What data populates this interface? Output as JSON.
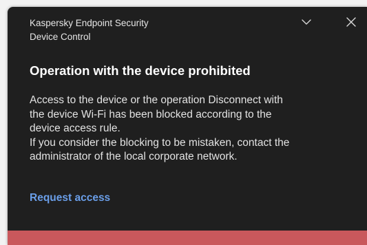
{
  "notification": {
    "app_name": "Kaspersky Endpoint Security",
    "component": "Device Control",
    "title": "Operation with the device prohibited",
    "body_lines": [
      "Access to the device or the operation Disconnect with",
      "the device Wi-Fi has been blocked according to the",
      "device access rule.",
      "If you consider the blocking to be mistaken, contact the",
      "administrator of the local corporate network."
    ],
    "action_label": "Request access",
    "icons": {
      "expand": "chevron-down-icon",
      "close": "close-icon"
    },
    "colors": {
      "background": "#1f1f1f",
      "link": "#6a9ee8",
      "status_bar": "#c9585c"
    }
  }
}
